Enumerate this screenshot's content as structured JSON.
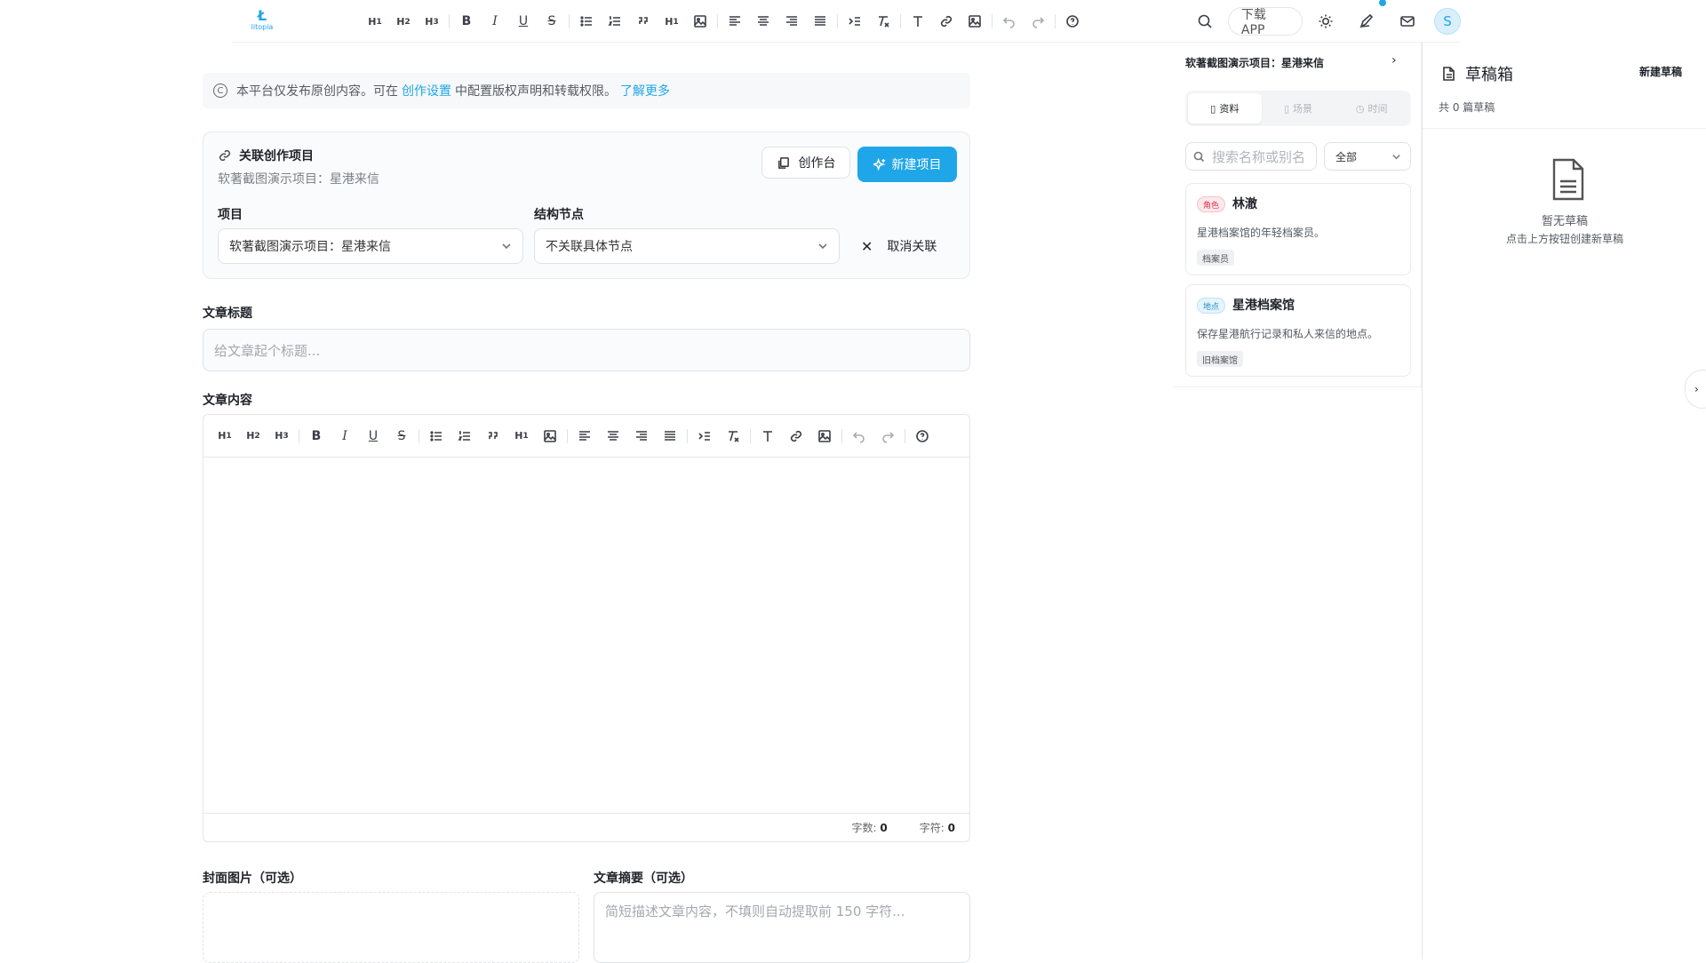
{
  "header": {
    "logo_text": "litopia",
    "toolbar_items": [
      "H1",
      "H2",
      "H3",
      "B",
      "I",
      "U",
      "S",
      "bullet-list",
      "ordered-list",
      "quote",
      "H1",
      "image",
      "align-left",
      "align-center",
      "align-right",
      "align-justify",
      "indent",
      "clear-format",
      "text",
      "link",
      "image",
      "undo",
      "redo",
      "help"
    ],
    "download_app": "下载APP",
    "avatar_initial": "S"
  },
  "notice": {
    "prefix": "本平台仅发布原创内容。可在",
    "link1": "创作设置",
    "middle": "中配置版权声明和转载权限。",
    "link2": "了解更多"
  },
  "assoc": {
    "title": "关联创作项目",
    "subtitle": "软著截图演示项目：星港来信",
    "workspace_button": "创作台",
    "new_project_button": "新建项目",
    "project_label": "项目",
    "project_value": "软著截图演示项目：星港来信",
    "node_label": "结构节点",
    "node_value": "不关联具体节点",
    "unlink_button": "取消关联"
  },
  "article": {
    "title_label": "文章标题",
    "title_placeholder": "给文章起个标题...",
    "content_label": "文章内容",
    "word_count_label": "字数:",
    "word_count": "0",
    "char_count_label": "字符:",
    "char_count": "0",
    "cover_label": "封面图片（可选）",
    "summary_label": "文章摘要（可选）",
    "summary_placeholder": "简短描述文章内容，不填则自动提取前 150 字符..."
  },
  "side": {
    "header": "软著截图演示项目：星港来信",
    "tabs": [
      {
        "label": "资料",
        "active": true
      },
      {
        "label": "场景",
        "active": false
      },
      {
        "label": "时间",
        "active": false
      }
    ],
    "search_placeholder": "搜索名称或别名",
    "filter_value": "全部",
    "cards": [
      {
        "tag": "角色",
        "tag_type": "role",
        "name": "林澈",
        "desc": "星港档案馆的年轻档案员。",
        "chip": "档案员"
      },
      {
        "tag": "地点",
        "tag_type": "place",
        "name": "星港档案馆",
        "desc": "保存星港航行记录和私人来信的地点。",
        "chip": "旧档案馆"
      }
    ]
  },
  "drafts": {
    "title": "草稿箱",
    "new_button": "新建草稿",
    "count": "共 0 篇草稿",
    "empty_title": "暂无草稿",
    "empty_hint": "点击上方按钮创建新草稿"
  },
  "colors": {
    "accent": "#1fa6e8",
    "role_tag": "#e0344e"
  }
}
